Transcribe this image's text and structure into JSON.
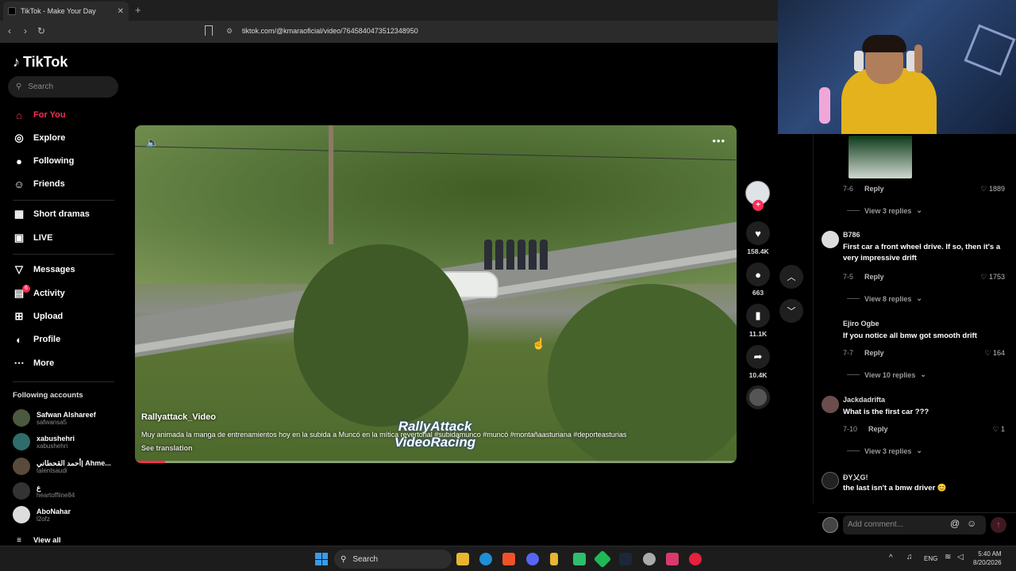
{
  "browser": {
    "tab_title": "TikTok - Make Your Day",
    "tab_close": "✕",
    "new_tab": "+",
    "url": "tiktok.com/@kmaraoficial/video/7645840473512348950"
  },
  "sidebar": {
    "logo_text": "TikTok",
    "search_placeholder": "Search",
    "nav": [
      {
        "label": "For You",
        "icon": "home-icon"
      },
      {
        "label": "Explore",
        "icon": "compass-icon"
      },
      {
        "label": "Following",
        "icon": "following-icon"
      },
      {
        "label": "Friends",
        "icon": "friends-icon"
      },
      {
        "label": "Short dramas",
        "icon": "film-icon"
      },
      {
        "label": "LIVE",
        "icon": "live-icon"
      },
      {
        "label": "Messages",
        "icon": "send-icon"
      },
      {
        "label": "Activity",
        "icon": "activity-icon"
      },
      {
        "label": "Upload",
        "icon": "upload-icon"
      },
      {
        "label": "Profile",
        "icon": "profile-icon"
      },
      {
        "label": "More",
        "icon": "more-icon"
      }
    ],
    "activity_badge": "6",
    "following_accounts_title": "Following accounts",
    "accounts": [
      {
        "name": "Safwan Alshareef",
        "handle": "safwansa5"
      },
      {
        "name": "xabushehri",
        "handle": "xabushehri"
      },
      {
        "name": "أحمد القحطاني| Ahme...",
        "handle": "talentsaudi"
      },
      {
        "name": "ع",
        "handle": "heartoffline84"
      },
      {
        "name": "AboNahar",
        "handle": "l2ofz"
      }
    ],
    "view_all": "View all"
  },
  "video": {
    "author": "Rallyattack_Video",
    "description": "Muy animada la manga de entrenamientos hoy en la subida a Muncó en la mítica revertonal #subidamunco #muncó #montañaasturiana #deporteasturias",
    "see_translation": "See translation",
    "watermark_line1": "RallyAttack",
    "watermark_line2": "VideoRacing",
    "progress_fraction": 0.05
  },
  "actions": {
    "likes": "158.4K",
    "comments": "663",
    "saves": "11.1K",
    "shares": "10.4K"
  },
  "comments": [
    {
      "user": "",
      "text": "",
      "date": "7-6",
      "reply": "Reply",
      "likes": "1889",
      "view_replies": "View 3 replies"
    },
    {
      "user": "B786",
      "text": "First car a front wheel drive. If so, then it's a very impressive drift",
      "date": "7-5",
      "reply": "Reply",
      "likes": "1753",
      "view_replies": "View 8 replies"
    },
    {
      "user": "Ejiro Ogbe",
      "text": "If you notice all bmw got smooth drift",
      "date": "7-7",
      "reply": "Reply",
      "likes": "164",
      "view_replies": "View 10 replies"
    },
    {
      "user": "Jackdadrifta",
      "text": "What is the first car ???",
      "date": "7-10",
      "reply": "Reply",
      "likes": "1",
      "view_replies": "View 3 replies"
    },
    {
      "user": "ĐY乂G!",
      "text": "the last isn't a bmw driver 😊",
      "date": "",
      "reply": "",
      "likes": "",
      "view_replies": ""
    }
  ],
  "add_comment_placeholder": "Add comment...",
  "taskbar": {
    "search": "Search",
    "lang": "ENG",
    "time": "5:40 AM",
    "date": "8/20/2026"
  },
  "colors": {
    "accent": "#fe2c55",
    "background": "#000000"
  }
}
